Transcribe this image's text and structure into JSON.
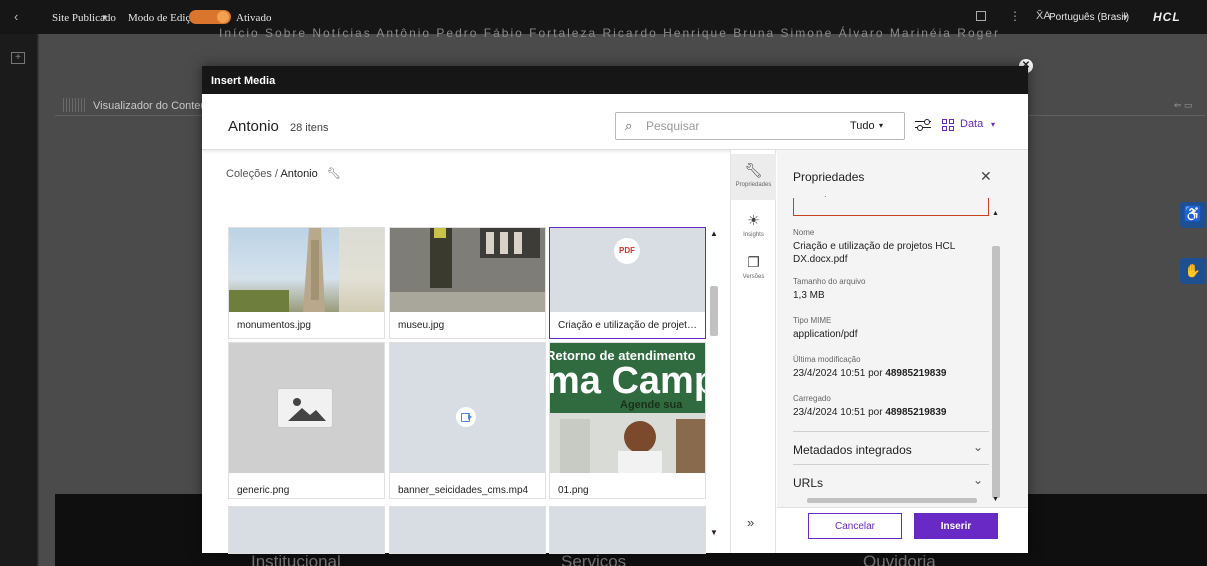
{
  "topbar": {
    "back_icon": "chevron-left-icon",
    "site_label": "Site Publicado",
    "site_caret": "▾",
    "edit_mode_label": "Modo de Edição:",
    "edit_mode_state": "Ativado",
    "toggle_color": "#d9752c",
    "menu_dots": "⋮",
    "lang_icon": "X̄A",
    "language": "Português (Brasil)",
    "lang_caret": "▾",
    "logo": "HCL"
  },
  "page": {
    "nav_strip": "Início     Sobre     Notícias     Antônio     Pedro     Fábio     Fortaleza     Ricardo     Henrique     Bruna     Simone     Álvaro     Marinéia     Roger",
    "content_viewer_title": "Visualizador do Conteúdo",
    "footer_links": [
      "Institucional",
      "Serviços",
      "Ouvidoria"
    ]
  },
  "modal": {
    "title": "Insert Media",
    "close_glyph": "✕",
    "folder_name": "Antonio",
    "item_count": "28 itens",
    "search_placeholder": "Pesquisar",
    "filter_value": "Tudo",
    "filter_caret": "▾",
    "sort_label": "Data",
    "sort_caret": "▾",
    "accent": "#6929c4",
    "breadcrumb": {
      "root": "Coleções",
      "separator": "/",
      "current": "Antonio"
    },
    "tiles": [
      {
        "name": "monumentos.jpg",
        "kind": "image"
      },
      {
        "name": "museu.jpg",
        "kind": "image"
      },
      {
        "name": "Criação e utilização de projetos HCL DX.docx.pdf",
        "kind": "pdf",
        "badge": "PDF",
        "selected": true
      },
      {
        "name": "generic.png",
        "kind": "placeholder"
      },
      {
        "name": "banner_seicidades_cms.mp4",
        "kind": "video"
      },
      {
        "name": "01.png",
        "kind": "banner"
      }
    ],
    "banner_text": {
      "line1": "Retorno de atendimento",
      "line2": "ma Campi",
      "line3": "Agende sua"
    },
    "side_tabs": [
      {
        "label": "Propriedades",
        "icon": "wrench-icon"
      },
      {
        "label": "Insights",
        "icon": "sun-icon"
      },
      {
        "label": "Versões",
        "icon": "versions-icon"
      }
    ],
    "side_collapse": "»",
    "properties": {
      "heading": "Propriedades",
      "close_glyph": "✕",
      "fields": [
        {
          "label": "Nome",
          "value": "Criação e utilização de projetos HCL DX.docx.pdf"
        },
        {
          "label": "Tamanho do arquivo",
          "value": "1,3 MB"
        },
        {
          "label": "Tipo MIME",
          "value": "application/pdf"
        },
        {
          "label": "Última modificação",
          "value": "23/4/2024 10:51 por",
          "user": "48985219839"
        },
        {
          "label": "Carregado",
          "value": "23/4/2024 10:51 por",
          "user": "48985219839"
        }
      ],
      "accordions": [
        "Metadados integrados",
        "URLs"
      ],
      "accordion_chevron": "⌄",
      "cancel_label": "Cancelar",
      "insert_label": "Inserir"
    }
  }
}
